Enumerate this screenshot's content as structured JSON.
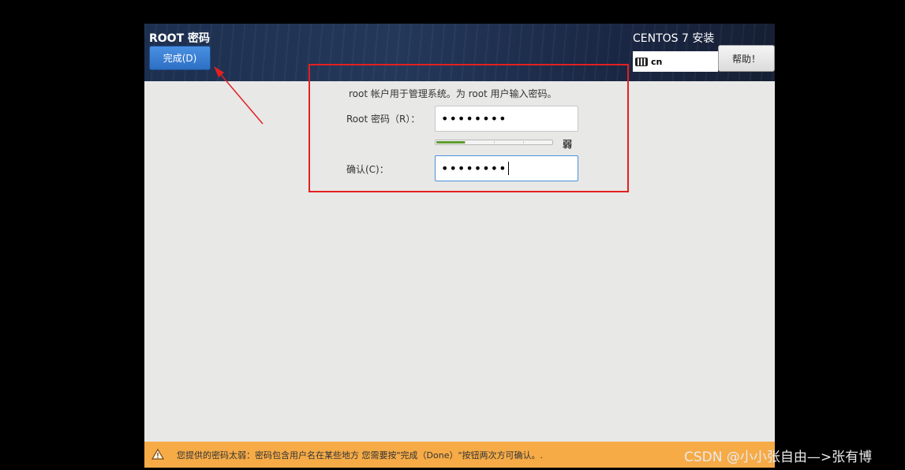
{
  "header": {
    "title": "ROOT 密码",
    "done_label": "完成(D)",
    "product": "CENTOS 7 安装",
    "keyboard_layout": "cn",
    "help_label": "帮助！"
  },
  "form": {
    "description": "root 帐户用于管理系统。为 root 用户输入密码。",
    "password_label": "Root 密码（R）：",
    "password_value": "••••••••",
    "strength_label": "弱",
    "strength_level": 0.25,
    "confirm_label": "确认(C)：",
    "confirm_value": "••••••••"
  },
  "warning": {
    "text": "您提供的密码太弱：密码包含用户名在某些地方 您需要按\"完成（Done）\"按钮两次方可确认。."
  },
  "watermark": "CSDN @小小张自由—>张有博",
  "colors": {
    "accent": "#3b82d6",
    "annotation": "#e32020",
    "warning_bg": "#f6ab47",
    "strength_weak": "#5f9b2f"
  }
}
